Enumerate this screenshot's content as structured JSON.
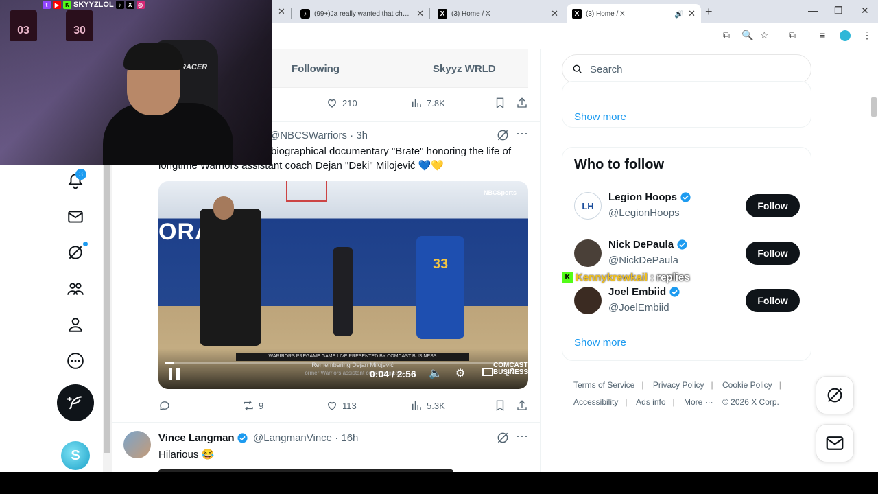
{
  "browser": {
    "tabs": [
      {
        "title": "(99+)Ja really wanted that challe"
      },
      {
        "title": "(3) Home / X"
      },
      {
        "title": "(3) Home / X"
      }
    ],
    "new_tab_glyph": "+",
    "window_controls": [
      "minimize",
      "restore",
      "close"
    ]
  },
  "webcam": {
    "channel_name": "SKYYZLOL",
    "chair_brand": "RACER",
    "jersey_numbers": [
      "03",
      "30"
    ]
  },
  "leftnav": {
    "notifications_badge": "3",
    "items": [
      "notifications-icon",
      "messages-icon",
      "grok-icon",
      "communities-icon",
      "profile-icon",
      "more-icon"
    ],
    "post_button_icon": "feather-plus-icon"
  },
  "feed": {
    "tabs": [
      {
        "label": "Following"
      },
      {
        "label": "Skyyz WRLD"
      }
    ],
    "prev_post_actions": {
      "likes": "210",
      "views": "7.8K"
    },
    "post1": {
      "handle": "@NBCSWarriors · 3h",
      "text_line1": "biographical documentary \"Brate\" honoring the life of",
      "text_line2": "longtime Warriors assistant coach Dejan \"Deki\" Milojević 💙💛",
      "video": {
        "court_brand": "ORACLE",
        "network_logo": "NBCSports",
        "jersey_number": "33",
        "banner": "WARRIORS PREGAME GAME LIVE PRESENTED BY COMCAST BUSINESS",
        "caption": "Remembering Dejan Milojević",
        "caption_sub": "Former Warriors assistant coach tragically",
        "time": "0:04 / 2:56",
        "progress": 0.023,
        "sponsor": "COMCAST BUSINESS"
      },
      "actions": {
        "replies": "",
        "reposts": "9",
        "likes": "113",
        "views": "5.3K"
      }
    },
    "post2": {
      "name": "Vince Langman",
      "handle": "@LangmanVince · 16h",
      "text": "Hilarious 😂"
    }
  },
  "right": {
    "search_placeholder": "Search",
    "show_more_1": "Show more",
    "who_to_follow_title": "Who to follow",
    "suggestions": [
      {
        "name": "Legion Hoops",
        "handle": "@LegionHoops",
        "button": "Follow",
        "avatar_color": "#e8f0fb"
      },
      {
        "name": "Nick DePaula",
        "handle": "@NickDePaula",
        "button": "Follow",
        "avatar_color": "#4a4038"
      },
      {
        "name": "Joel Embiid",
        "handle": "@JoelEmbiid",
        "button": "Follow",
        "avatar_color": "#3b2b22"
      }
    ],
    "show_more_2": "Show more",
    "footer": {
      "terms": "Terms of Service",
      "privacy": "Privacy Policy",
      "cookie": "Cookie Policy",
      "accessibility": "Accessibility",
      "ads": "Ads info",
      "more": "More ···",
      "copyright": "© 2026 X Corp."
    }
  },
  "stream_overlay": {
    "username": "Kennykrewkail",
    "suffix": ": replies"
  },
  "colors": {
    "accent": "#1d9bf0",
    "text": "#0f1419",
    "muted": "#536471"
  }
}
